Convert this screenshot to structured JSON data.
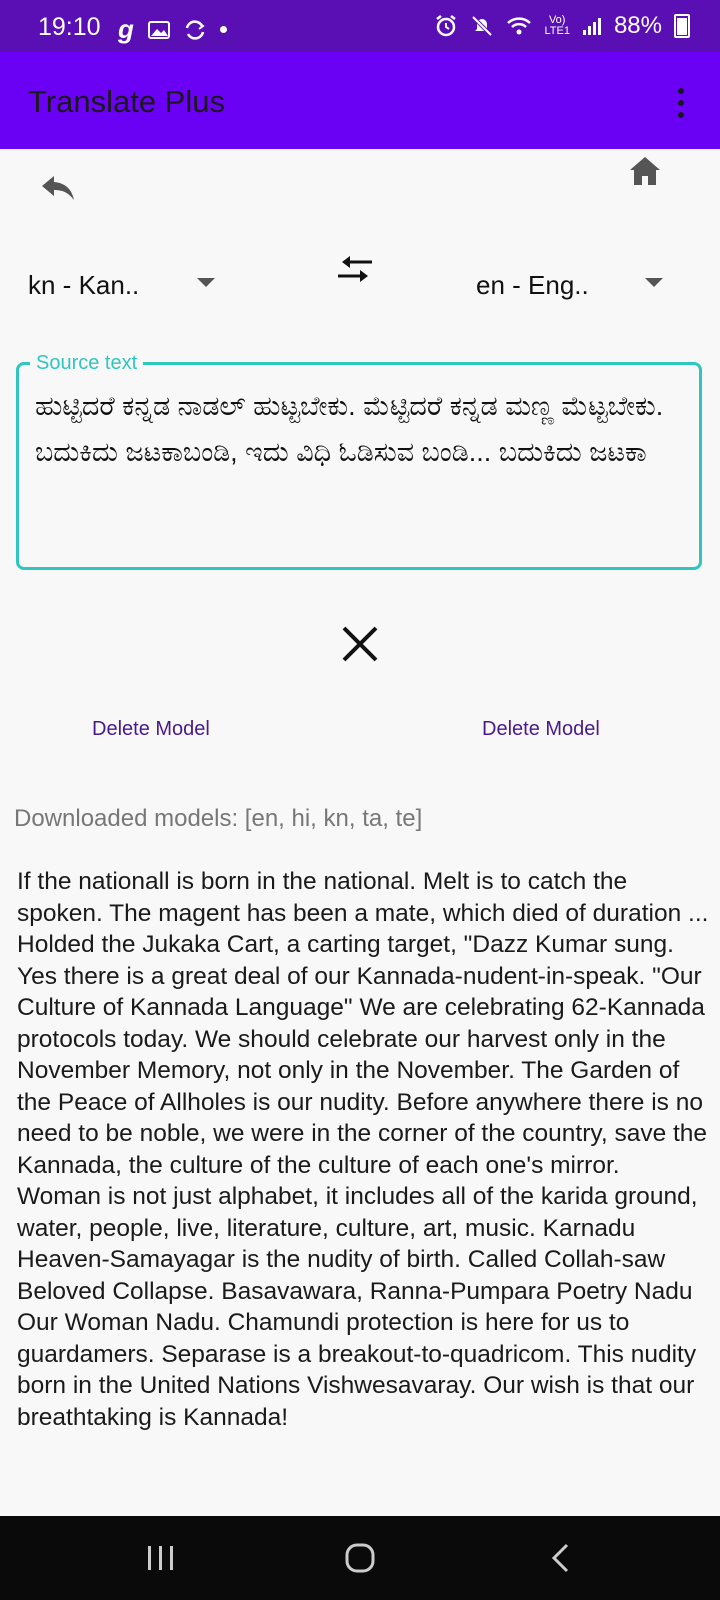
{
  "status_bar": {
    "time": "19:10",
    "left_icons": [
      "g-icon",
      "gallery-icon",
      "sync-icon",
      "dot-icon"
    ],
    "right_icons": [
      "alarm-icon",
      "mute-icon",
      "wifi-icon",
      "volte-icon",
      "signal-icon"
    ],
    "battery": "88%"
  },
  "app_bar": {
    "title": "Translate Plus",
    "menu_icon": "more-vert-icon"
  },
  "toolbar": {
    "back_icon": "reply-icon",
    "home_icon": "home-icon"
  },
  "languages": {
    "source": "kn - Kan..",
    "target": "en - Eng..",
    "swap_icon": "swap-icon"
  },
  "source": {
    "label": "Source text",
    "text": "ಹುಟ್ಟಿದರೆ ಕನ್ನಡ ನಾಡಲ್ ಹುಟ್ಟಬೇಕು. ಮೆಟ್ಟಿದರೆ ಕನ್ನಡ ಮಣ್ಣ ಮೆಟ್ಟಬೇಕು. ಬದುಕಿದು ಜಟಕಾಬಂಡಿ, ಇದು ವಿಧಿ ಓಡಿಸುವ ಬಂಡಿ... ಬದುಕಿದು ಜಟಕಾ"
  },
  "clear_icon": "close-icon",
  "actions": {
    "delete_left": "Delete Model",
    "delete_right": "Delete Model"
  },
  "downloaded_models": "Downloaded models: [en, hi, kn, ta, te]",
  "output_text": "If the nationall is born in the national. Melt is to catch the spoken. The magent has been a mate, which died of duration ... Holded the Jukaka Cart, a carting target, \"Dazz Kumar sung. Yes there is a great deal of our Kannada-nudent-in-speak. \"Our Culture of Kannada Language\" We are celebrating 62-Kannada protocols today. We should celebrate our harvest only in the November Memory, not only in the November. The Garden of the Peace of Allholes is our nudity. Before anywhere there is no need to be noble, we were in the corner of the country, save the Kannada, the culture of the culture of each one's mirror. Woman is not just alphabet, it includes all of the karida ground, water, people, live, literature, culture, art, music. Karnadu Heaven-Samayagar is the nudity of birth. Called Collah-saw Beloved Collapse. Basavawara, Ranna-Pumpara Poetry Nadu Our Woman Nadu. Chamundi protection is here for us to guardamers. Separase is a breakout-to-quadricom. This nudity born in the United Nations Vishwesavaray. Our wish is that our breathtaking is Kannada!",
  "nav_bar": {
    "icons": [
      "recent-apps-icon",
      "home-nav-icon",
      "back-nav-icon"
    ]
  },
  "colors": {
    "status_bar": "#5a0fb4",
    "app_bar": "#6a00f4",
    "accent": "#2fc6c0",
    "delete_text": "#4a1a8a"
  }
}
